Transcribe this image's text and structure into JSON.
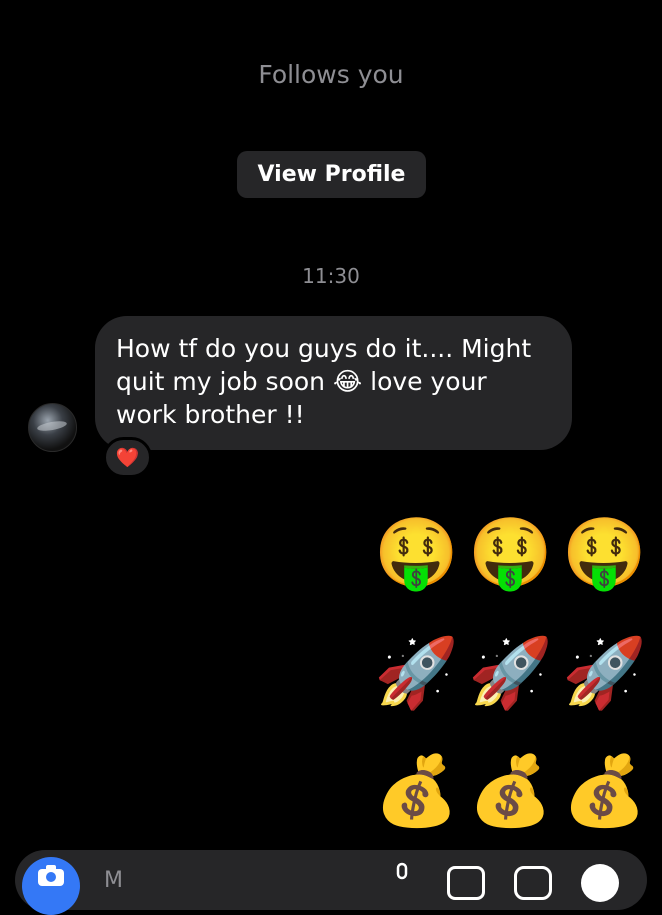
{
  "header": {
    "follows_text": "Follows you",
    "view_profile_label": "View Profile"
  },
  "thread": {
    "timestamp": "11:30",
    "incoming_message": {
      "text": "How tf do you guys do it.... Might quit my job soon 😂 love your work brother !!",
      "reaction": "❤️"
    },
    "outgoing_emoji_rows": [
      [
        "🤑",
        "🤑",
        "🤑"
      ],
      [
        "🚀",
        "🚀",
        "🚀"
      ],
      [
        "💰",
        "💰",
        "💰"
      ]
    ]
  },
  "composer": {
    "placeholder": "M",
    "icons": [
      "camera-icon",
      "mic-icon",
      "gallery-icon",
      "sticker-icon",
      "plus-icon"
    ]
  },
  "colors": {
    "background": "#000000",
    "bubble": "#262628",
    "secondary_text": "#8e8e93",
    "accent": "#3478f6"
  }
}
